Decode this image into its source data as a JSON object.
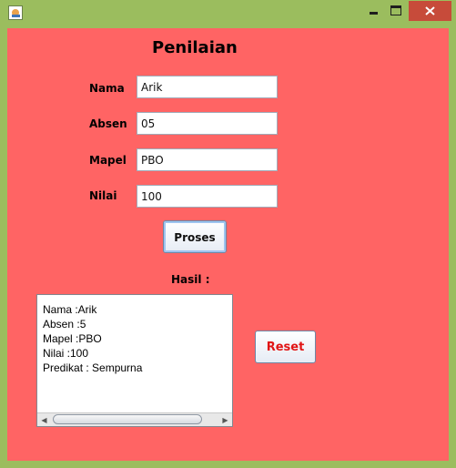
{
  "window": {
    "title": "",
    "icon": "java-app-icon",
    "controls": [
      "minimize-icon",
      "maximize-icon",
      "close-icon"
    ],
    "colors": {
      "frame": "#9bbd5e",
      "content_bg": "#ff6464",
      "close": "#c74b3a"
    }
  },
  "form": {
    "title": "Penilaian",
    "fields": [
      {
        "label": "Nama",
        "value": "Arik"
      },
      {
        "label": "Absen",
        "value": "05"
      },
      {
        "label": "Mapel",
        "value": "PBO"
      },
      {
        "label": "Nilai",
        "value": "100"
      }
    ],
    "proses_label": "Proses",
    "reset_label": "Reset",
    "hasil_label": "Hasil :"
  },
  "result": {
    "lines": [
      "Nama :Arik",
      "Absen :5",
      "Mapel :PBO",
      "Nilai :100",
      "Predikat : Sempurna"
    ]
  }
}
